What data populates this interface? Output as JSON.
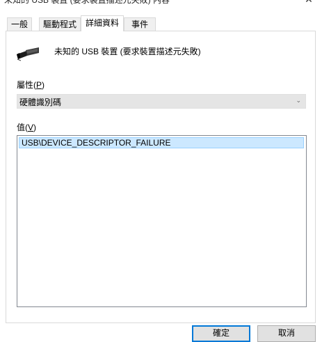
{
  "window": {
    "title": "未知的 USB 裝置 (要求裝置描述元失敗) 內容",
    "close_glyph": "✕"
  },
  "tabs": [
    {
      "label": "一般",
      "active": false
    },
    {
      "label": "驅動程式",
      "active": false
    },
    {
      "label": "詳細資料",
      "active": true
    },
    {
      "label": "事件",
      "active": false
    }
  ],
  "device": {
    "icon": "usb-connector-icon",
    "name": "未知的 USB 裝置 (要求裝置描述元失敗)"
  },
  "property": {
    "label_text": "屬性(",
    "label_accel": "P",
    "label_end": ")",
    "selected": "硬體識別碼",
    "chevron": "⌄"
  },
  "value": {
    "label_text": "值(",
    "label_accel": "V",
    "label_end": ")",
    "items": [
      "USB\\DEVICE_DESCRIPTOR_FAILURE"
    ]
  },
  "buttons": {
    "ok": "確定",
    "cancel": "取消"
  },
  "colors": {
    "selection_bg": "#cce8ff",
    "selection_border": "#99d1ff",
    "accent": "#0078d7"
  }
}
